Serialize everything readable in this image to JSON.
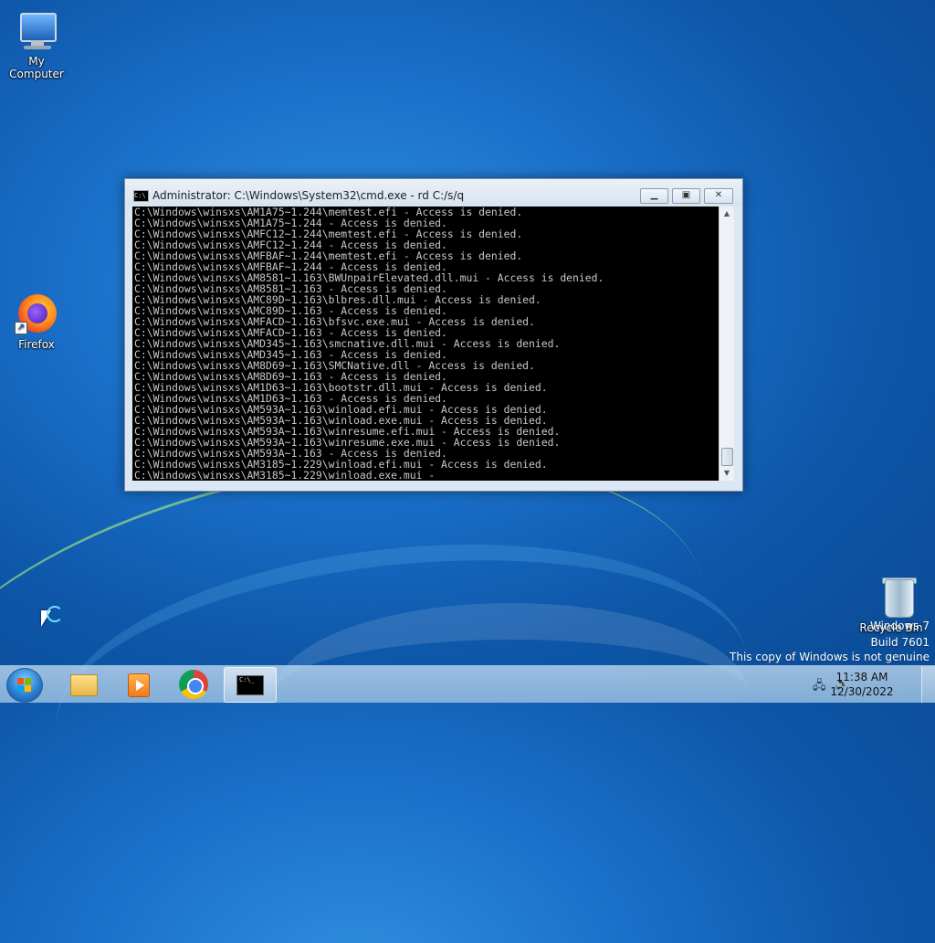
{
  "desktop": {
    "icons": [
      {
        "id": "my-computer",
        "label": "My Computer",
        "icon": "computer-icon"
      },
      {
        "id": "firefox",
        "label": "Firefox",
        "icon": "firefox-icon"
      },
      {
        "id": "recycle-bin",
        "label": "Recycle Bin",
        "icon": "recycle-bin-icon"
      }
    ],
    "watermark": {
      "line1": "Windows 7",
      "line2": "Build 7601",
      "line3": "This copy of Windows is not genuine"
    }
  },
  "cmd_window": {
    "title": "Administrator: C:\\Windows\\System32\\cmd.exe - rd  C:/s/q",
    "buttons": {
      "minimize": "minimize-icon",
      "maximize": "maximize-icon",
      "close": "close-icon"
    },
    "lines": [
      "C:\\Windows\\winsxs\\AM1A75~1.244\\memtest.efi - Access is denied.",
      "C:\\Windows\\winsxs\\AM1A75~1.244 - Access is denied.",
      "C:\\Windows\\winsxs\\AMFC12~1.244\\memtest.efi - Access is denied.",
      "C:\\Windows\\winsxs\\AMFC12~1.244 - Access is denied.",
      "C:\\Windows\\winsxs\\AMFBAF~1.244\\memtest.efi - Access is denied.",
      "C:\\Windows\\winsxs\\AMFBAF~1.244 - Access is denied.",
      "C:\\Windows\\winsxs\\AM8581~1.163\\BWUnpairElevated.dll.mui - Access is denied.",
      "C:\\Windows\\winsxs\\AM8581~1.163 - Access is denied.",
      "C:\\Windows\\winsxs\\AMC89D~1.163\\blbres.dll.mui - Access is denied.",
      "C:\\Windows\\winsxs\\AMC89D~1.163 - Access is denied.",
      "C:\\Windows\\winsxs\\AMFACD~1.163\\bfsvc.exe.mui - Access is denied.",
      "C:\\Windows\\winsxs\\AMFACD~1.163 - Access is denied.",
      "C:\\Windows\\winsxs\\AMD345~1.163\\smcnative.dll.mui - Access is denied.",
      "C:\\Windows\\winsxs\\AMD345~1.163 - Access is denied.",
      "C:\\Windows\\winsxs\\AM8D69~1.163\\SMCNative.dll - Access is denied.",
      "C:\\Windows\\winsxs\\AM8D69~1.163 - Access is denied.",
      "C:\\Windows\\winsxs\\AM1D63~1.163\\bootstr.dll.mui - Access is denied.",
      "C:\\Windows\\winsxs\\AM1D63~1.163 - Access is denied.",
      "C:\\Windows\\winsxs\\AM593A~1.163\\winload.efi.mui - Access is denied.",
      "C:\\Windows\\winsxs\\AM593A~1.163\\winload.exe.mui - Access is denied.",
      "C:\\Windows\\winsxs\\AM593A~1.163\\winresume.efi.mui - Access is denied.",
      "C:\\Windows\\winsxs\\AM593A~1.163\\winresume.exe.mui - Access is denied.",
      "C:\\Windows\\winsxs\\AM593A~1.163 - Access is denied.",
      "C:\\Windows\\winsxs\\AM3185~1.229\\winload.efi.mui - Access is denied.",
      "C:\\Windows\\winsxs\\AM3185~1.229\\winload.exe.mui -"
    ]
  },
  "taskbar": {
    "pinned": [
      {
        "name": "file-explorer",
        "icon": "folder-icon"
      },
      {
        "name": "media-player",
        "icon": "media-player-icon"
      },
      {
        "name": "chrome",
        "icon": "chrome-icon"
      },
      {
        "name": "cmd",
        "icon": "cmd-icon",
        "active": true
      }
    ],
    "clock": {
      "time": "11:38 AM",
      "date": "12/30/2022"
    }
  }
}
